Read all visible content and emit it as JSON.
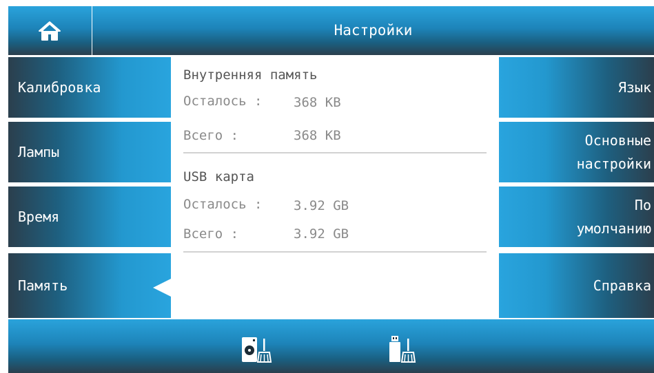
{
  "header": {
    "title": "Настройки",
    "home_icon": "home-icon"
  },
  "left_menu": [
    {
      "label": "Калибровка"
    },
    {
      "label": "Лампы"
    },
    {
      "label": "Время"
    },
    {
      "label": "Память",
      "selected": true
    }
  ],
  "right_menu": [
    {
      "label": "Язык"
    },
    {
      "label": "Основные\nнастройки"
    },
    {
      "label": "По\nумолчанию"
    },
    {
      "label": "Справка"
    }
  ],
  "memory": {
    "internal": {
      "title": "Внутренняя память",
      "remaining_label": "Осталось :",
      "remaining": "368 KB",
      "total_label": "Всего :",
      "total": "368 KB"
    },
    "usb": {
      "title": "USB карта",
      "remaining_label": "Осталось :",
      "remaining": "3.92 GB",
      "total_label": "Всего :",
      "total": "3.92 GB"
    }
  },
  "footer": {
    "icons": [
      "clean-internal-memory-icon",
      "clean-usb-icon"
    ]
  },
  "colors": {
    "accent": "#29a4de",
    "dark": "#2b3f4d",
    "text_gray": "#8a8a8a"
  }
}
